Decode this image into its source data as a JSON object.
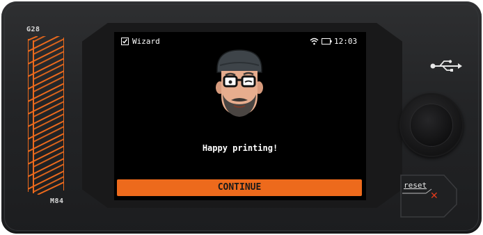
{
  "device": {
    "label_top": "G28",
    "label_bottom": "M84",
    "accent_color": "#ed6a1c"
  },
  "status_bar": {
    "title": "Wizard",
    "title_icon": "checkbox-icon",
    "wifi_icon": "wifi-icon",
    "battery_icon": "battery-icon",
    "time": "12:03"
  },
  "main": {
    "avatar_icon": "avatar-face-icon",
    "message": "Happy printing!",
    "continue_label": "CONTINUE"
  },
  "hardware": {
    "usb_icon": "usb-icon",
    "knob": "rotary-knob",
    "reset_label": "reset",
    "reset_icon": "close-x-icon"
  }
}
